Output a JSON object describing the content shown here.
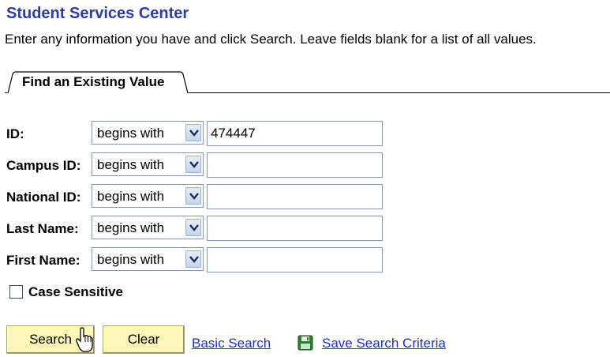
{
  "header": {
    "title": "Student Services Center",
    "instructions": "Enter any information you have and click Search. Leave fields blank for a list of all values."
  },
  "tab": {
    "label": "Find an Existing Value"
  },
  "fields": [
    {
      "label": "ID:",
      "operator": "begins with",
      "value": "474447"
    },
    {
      "label": "Campus ID:",
      "operator": "begins with",
      "value": ""
    },
    {
      "label": "National ID:",
      "operator": "begins with",
      "value": ""
    },
    {
      "label": "Last Name:",
      "operator": "begins with",
      "value": ""
    },
    {
      "label": "First Name:",
      "operator": "begins with",
      "value": ""
    }
  ],
  "case_sensitive": {
    "label": "Case Sensitive",
    "checked": false
  },
  "buttons": {
    "search": "Search",
    "clear": "Clear"
  },
  "links": {
    "basic_search": "Basic Search",
    "save_search": "Save Search Criteria"
  },
  "icons": {
    "save": "save-disk-icon",
    "cursor": "hand-pointer-icon",
    "dropdown": "chevron-down-icon"
  },
  "colors": {
    "title": "#2f3d9c",
    "button_bg": "#fcf8b8",
    "link": "#1d2ec7"
  }
}
